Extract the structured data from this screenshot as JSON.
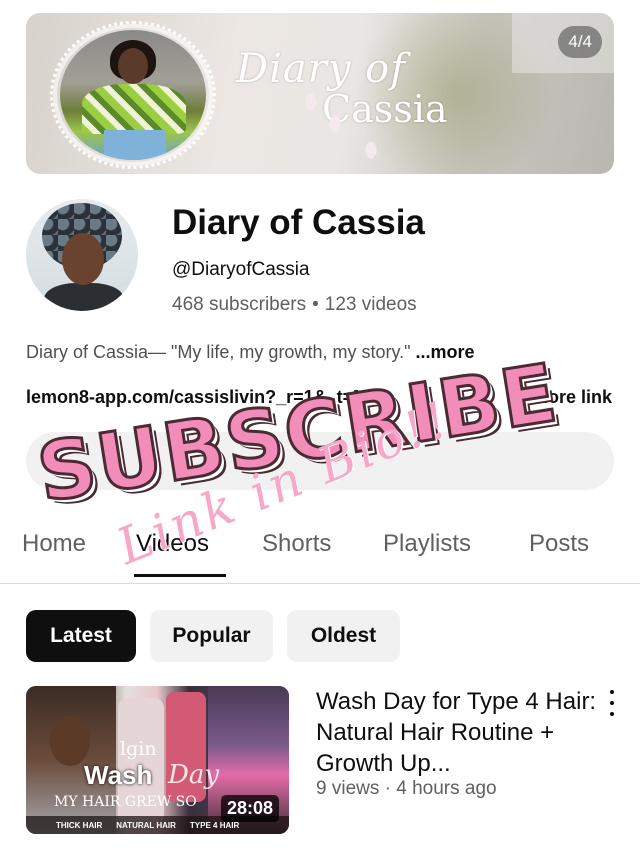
{
  "banner": {
    "script_line1": "Diary of",
    "script_line2": "Cassia",
    "image_counter": "4/4"
  },
  "channel": {
    "name": "Diary of Cassia",
    "handle": "@DiaryofCassia",
    "subscribers": "468 subscribers",
    "separator": "•",
    "videos": "123 videos",
    "description": "Diary of Cassia— \"My life, my growth, my story.\"",
    "description_more": "...more",
    "link": "lemon8-app.com/cassislivin?_r=1&_t=MG",
    "link_more": "more link"
  },
  "tabs": [
    {
      "label": "Home"
    },
    {
      "label": "Videos"
    },
    {
      "label": "Shorts"
    },
    {
      "label": "Playlists"
    },
    {
      "label": "Posts"
    }
  ],
  "filters": [
    {
      "label": "Latest"
    },
    {
      "label": "Popular"
    },
    {
      "label": "Oldest"
    }
  ],
  "video": {
    "title": "Wash Day for Type 4 Hair: Natural Hair Routine + Growth Up...",
    "meta": "9 views · 4 hours ago",
    "duration": "28:08",
    "thumb_brand": "lgin",
    "thumb_wash": "Wash",
    "thumb_day": "Day",
    "thumb_grew": "MY HAIR GREW SO",
    "thumb_tags": [
      "THICK HAIR",
      "NATURAL HAIR",
      "TYPE 4 HAIR"
    ]
  },
  "overlay": {
    "subscribe": "SUBSCRIBE",
    "link_in_bio": "Link in Bio!!"
  },
  "colors": {
    "sticker_pink": "#f28cb8",
    "sticker_outline": "#4a2a33",
    "active_chip": "#0f0f0f",
    "chip": "#f1f1f1"
  },
  "icons": [
    "more-vert-icon"
  ]
}
